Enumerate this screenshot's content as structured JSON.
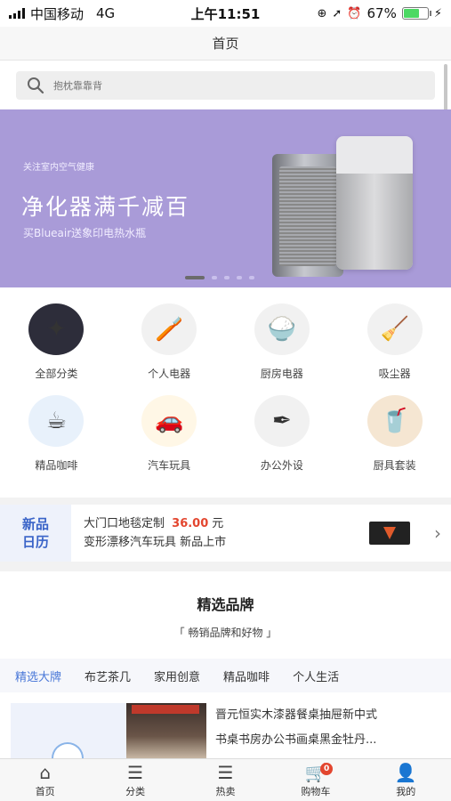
{
  "status_bar": {
    "carrier": "中国移动",
    "network": "4G",
    "time": "上午11:51",
    "battery": "67%",
    "battery_level": 0.67
  },
  "header": {
    "title": "首页"
  },
  "search": {
    "placeholder": "抱枕靠靠背"
  },
  "banner": {
    "small_text": "关注室内空气健康",
    "title": "净化器满千减百",
    "subtitle": "买Blueair送象印电热水瓶",
    "dot_count": 5,
    "active_dot": 0
  },
  "categories": [
    {
      "label": "全部分类",
      "icon": "all-categories-icon"
    },
    {
      "label": "个人电器",
      "icon": "toothbrush-icon"
    },
    {
      "label": "厨房电器",
      "icon": "rice-cooker-icon"
    },
    {
      "label": "吸尘器",
      "icon": "vacuum-icon"
    },
    {
      "label": "精品咖啡",
      "icon": "coffee-icon"
    },
    {
      "label": "汽车玩具",
      "icon": "toy-car-icon"
    },
    {
      "label": "办公外设",
      "icon": "pen-icon"
    },
    {
      "label": "厨具套装",
      "icon": "cup-icon"
    }
  ],
  "new_products": {
    "badge_line1": "新品",
    "badge_line2": "日历",
    "line1_prefix": "大门口地毯定制",
    "line1_price": "36.00",
    "line1_suffix": "元",
    "line2": "变形漂移汽车玩具 新品上市"
  },
  "brands": {
    "title": "精选品牌",
    "subtitle": "「 畅销品牌和好物 」",
    "tabs": [
      "精选大牌",
      "布艺茶几",
      "家用创意",
      "精品咖啡",
      "个人生活"
    ],
    "active_tab": 0
  },
  "product": {
    "line1": "晋元恒实木漆器餐桌抽屉新中式",
    "line2": "书桌书房办公书画桌黑金牡丹..."
  },
  "tab_bar": {
    "items": [
      {
        "label": "首页",
        "icon": "home-icon"
      },
      {
        "label": "分类",
        "icon": "list-icon"
      },
      {
        "label": "热卖",
        "icon": "list-icon"
      },
      {
        "label": "购物车",
        "icon": "cart-icon"
      },
      {
        "label": "我的",
        "icon": "user-icon"
      }
    ],
    "cart_count": "0"
  },
  "colors": {
    "banner_bg": "#a99bd8",
    "accent_blue": "#4a78d8",
    "price_red": "#e3462f"
  }
}
